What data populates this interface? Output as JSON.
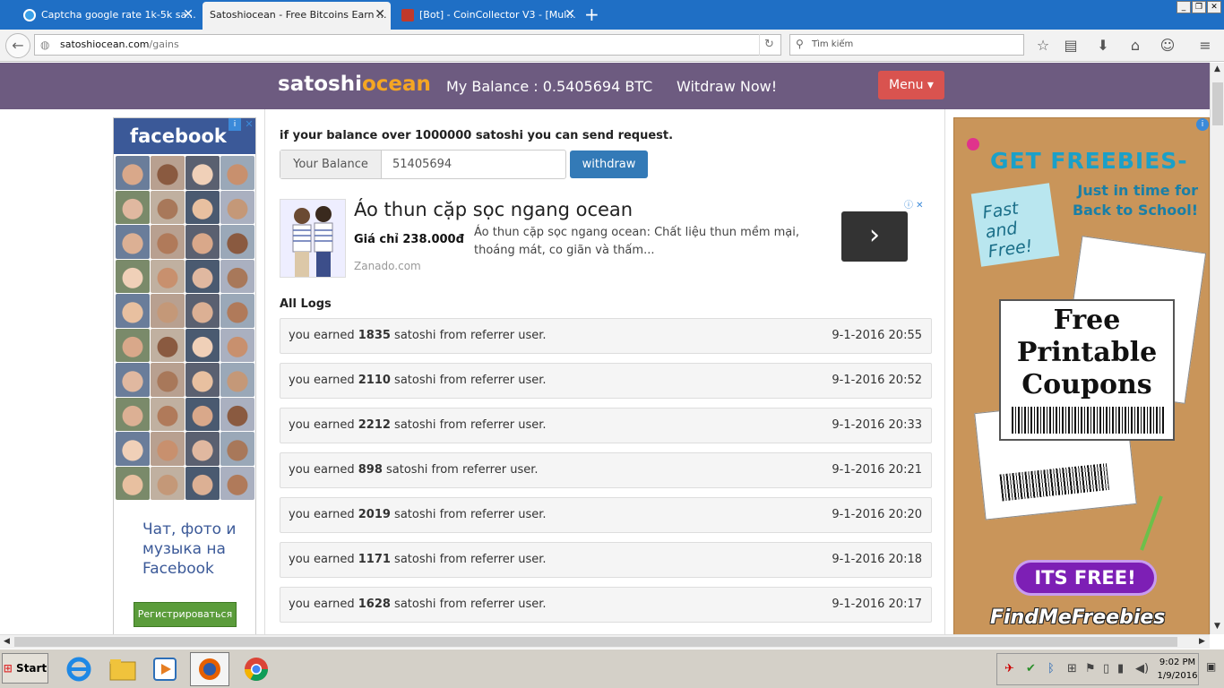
{
  "browser": {
    "tabs": [
      {
        "label": "Captcha google rate 1k-5k sa..."
      },
      {
        "label": "Satoshiocean - Free Bitcoins Earn ..."
      },
      {
        "label": "[Bot] - CoinCollector V3 - [Mul..."
      }
    ],
    "url_domain": "satoshiocean.com",
    "url_path": "/gains",
    "search_placeholder": "Tìm kiếm"
  },
  "site": {
    "logo_part1": "satoshi",
    "logo_part2": "ocean",
    "balance_text": "My Balance : 0.5405694 BTC",
    "withdraw_now": "Witdraw Now!",
    "menu_label": "Menu ▾"
  },
  "withdraw": {
    "request_text": "if your balance over 1000000 satoshi you can send request.",
    "balance_label": "Your Balance",
    "balance_value": "51405694",
    "button_label": "withdraw"
  },
  "ad_banner": {
    "title": "Áo thun cặp sọc ngang ocean",
    "price": "Giá chỉ 238.000đ",
    "description": "Áo thun cặp sọc ngang ocean: Chất liệu thun mềm mại, thoáng mát, co giãn và thấm...",
    "domain": "Zanado.com",
    "arrow": "›"
  },
  "logs": {
    "heading": "All Logs",
    "rows": [
      {
        "prefix": "you earned ",
        "amount": "1835",
        "suffix": " satoshi from referrer user.",
        "time": "9-1-2016 20:55"
      },
      {
        "prefix": "you earned ",
        "amount": "2110",
        "suffix": " satoshi from referrer user.",
        "time": "9-1-2016 20:52"
      },
      {
        "prefix": "you earned ",
        "amount": "2212",
        "suffix": " satoshi from referrer user.",
        "time": "9-1-2016 20:33"
      },
      {
        "prefix": "you earned ",
        "amount": "898",
        "suffix": " satoshi from referrer user.",
        "time": "9-1-2016 20:21"
      },
      {
        "prefix": "you earned ",
        "amount": "2019",
        "suffix": " satoshi from referrer user.",
        "time": "9-1-2016 20:20"
      },
      {
        "prefix": "you earned ",
        "amount": "1171",
        "suffix": " satoshi from referrer user.",
        "time": "9-1-2016 20:18"
      },
      {
        "prefix": "you earned ",
        "amount": "1628",
        "suffix": " satoshi from referrer user.",
        "time": "9-1-2016 20:17"
      }
    ]
  },
  "fb_ad": {
    "brand": "facebook",
    "text": "Чат, фото и музыка на Facebook",
    "button": "Регистрироваться"
  },
  "right_ad": {
    "headline": "GET FREEBIES-",
    "subline": "Just in time for Back to School!",
    "note": "Fast and Free!",
    "coupon_text": "Free Printable Coupons",
    "cta": "ITS FREE!",
    "brand": "FindMeFreebies"
  },
  "taskbar": {
    "start": "Start",
    "time": "9:02 PM",
    "date": "1/9/2016"
  },
  "colors": {
    "header_bg": "#6d5b80",
    "logo_accent": "#f5a623",
    "menu_btn": "#d9534f",
    "withdraw_btn": "#337ab7",
    "fb_blue": "#3b5998"
  }
}
